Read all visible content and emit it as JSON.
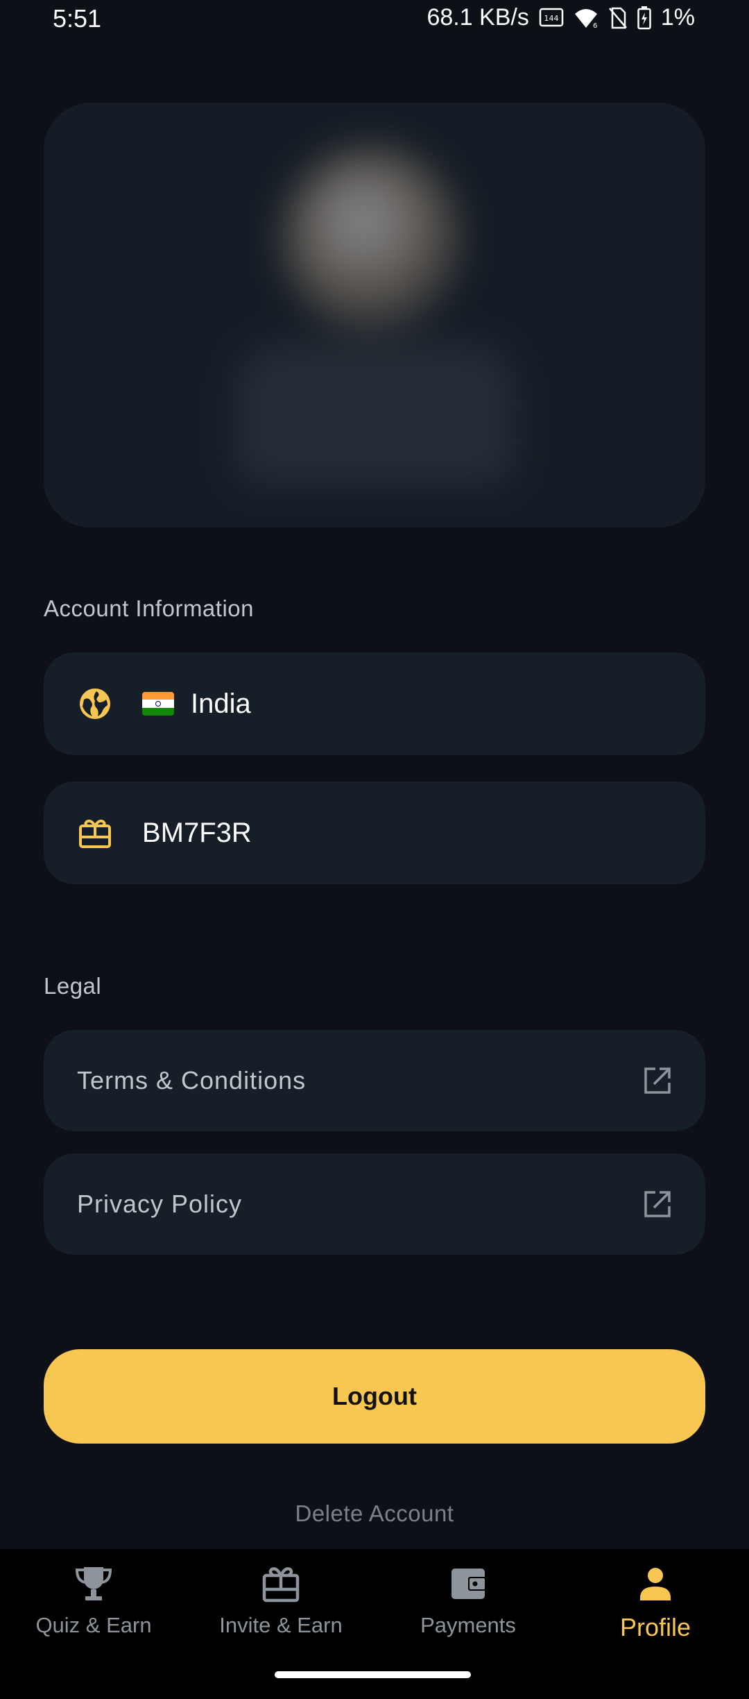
{
  "status_bar": {
    "time": "5:51",
    "network_speed": "68.1 KB/s",
    "refresh_badge": "144 Hz",
    "battery": "1%"
  },
  "account": {
    "section_title": "Account Information",
    "country": "India",
    "country_icon": "globe-icon",
    "referral_code": "BM7F3R",
    "referral_icon": "gift-card-icon"
  },
  "legal": {
    "section_title": "Legal",
    "items": [
      {
        "label": "Terms & Conditions",
        "icon": "external-link-icon"
      },
      {
        "label": "Privacy Policy",
        "icon": "external-link-icon"
      }
    ]
  },
  "actions": {
    "logout_label": "Logout",
    "delete_label": "Delete Account"
  },
  "bottom_nav": {
    "items": [
      {
        "label": "Quiz & Earn",
        "icon": "trophy-icon",
        "active": false
      },
      {
        "label": "Invite & Earn",
        "icon": "gift-icon",
        "active": false
      },
      {
        "label": "Payments",
        "icon": "wallet-icon",
        "active": false
      },
      {
        "label": "Profile",
        "icon": "person-icon",
        "active": true
      }
    ]
  },
  "colors": {
    "background": "#0d1117",
    "card": "#161e28",
    "accent": "#f8c751",
    "inactive": "#8e949b"
  }
}
